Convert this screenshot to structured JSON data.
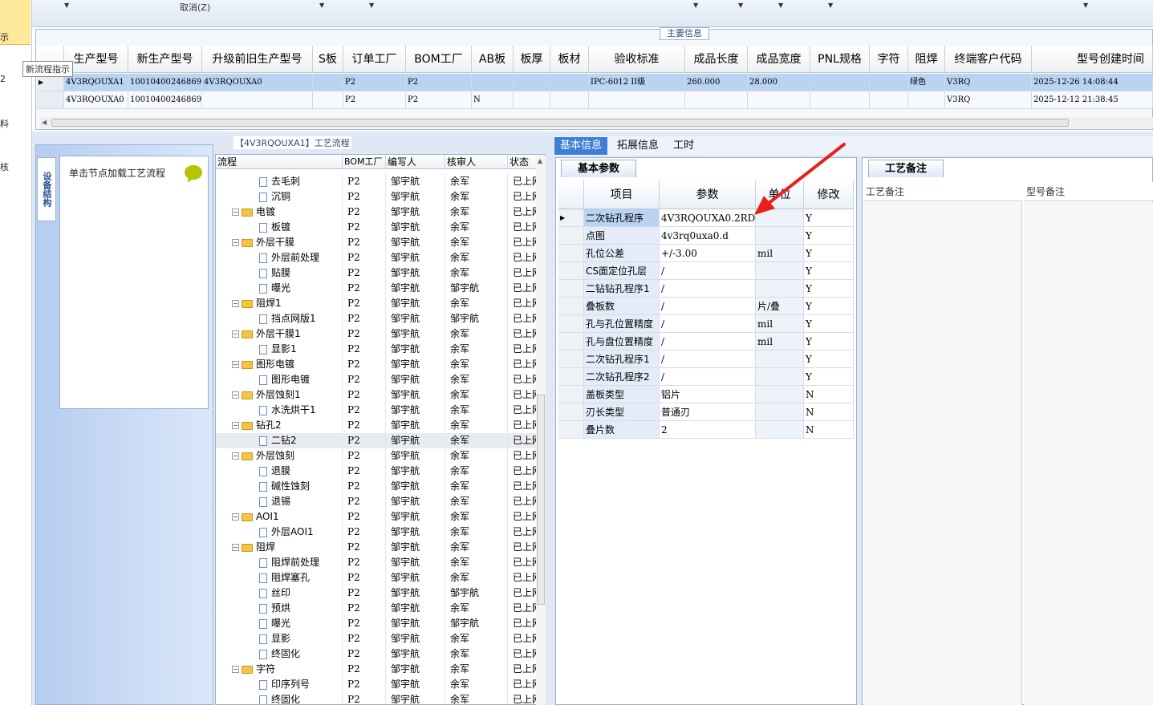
{
  "toolbar": {
    "cancel_label": "取消(Z)"
  },
  "leftstrip": {
    "items": [
      "示",
      "2",
      "料",
      "核"
    ]
  },
  "tooltip": "新流程指示",
  "main_info": {
    "title": "主要信息",
    "columns": [
      "生产型号",
      "新生产型号",
      "升级前旧生产型号",
      "S板",
      "订单工厂",
      "BOM工厂",
      "AB板",
      "板厚",
      "板材",
      "验收标准",
      "成品长度",
      "成品宽度",
      "PNL规格",
      "字符",
      "阻焊",
      "终端客户代码",
      "型号创建时间"
    ],
    "rows": [
      [
        "4V3RQOUXA1",
        "10010400246869",
        "4V3RQOUXA0",
        "",
        "P2",
        "P2",
        "",
        "",
        "",
        "IPC-6012 II级",
        "260.000",
        "28.000",
        "",
        "",
        "绿色",
        "V3RQ",
        "2025-12-26 14:08:44"
      ],
      [
        "4V3RQOUXA0",
        "10010400246869",
        "",
        "",
        "P2",
        "P2",
        "N",
        "",
        "",
        "",
        "",
        "",
        "",
        "",
        "",
        "V3RQ",
        "2025-12-12 21:38:45"
      ]
    ]
  },
  "side": {
    "tab_label": "设备结构",
    "hint": "单击节点加载工艺流程"
  },
  "flow": {
    "title": "【4V3RQOUXA1】工艺流程",
    "columns": [
      "流程",
      "BOM工厂",
      "编写人",
      "核审人",
      "状态"
    ],
    "rows": [
      {
        "name": "去毛刺",
        "level": 2,
        "bom": "P2",
        "writer": "邹宇航",
        "reviewer": "余军",
        "status": "已上网"
      },
      {
        "name": "沉铜",
        "level": 2,
        "bom": "P2",
        "writer": "邹宇航",
        "reviewer": "余军",
        "status": "已上网"
      },
      {
        "name": "电镀",
        "level": 1,
        "bom": "P2",
        "writer": "邹宇航",
        "reviewer": "余军",
        "status": "已上网"
      },
      {
        "name": "板镀",
        "level": 2,
        "bom": "P2",
        "writer": "邹宇航",
        "reviewer": "余军",
        "status": "已上网"
      },
      {
        "name": "外层干膜",
        "level": 1,
        "bom": "P2",
        "writer": "邹宇航",
        "reviewer": "余军",
        "status": "已上网"
      },
      {
        "name": "外层前处理",
        "level": 2,
        "bom": "P2",
        "writer": "邹宇航",
        "reviewer": "余军",
        "status": "已上网"
      },
      {
        "name": "贴膜",
        "level": 2,
        "bom": "P2",
        "writer": "邹宇航",
        "reviewer": "余军",
        "status": "已上网"
      },
      {
        "name": "曝光",
        "level": 2,
        "bom": "P2",
        "writer": "邹宇航",
        "reviewer": "邹宇航",
        "status": "已上网"
      },
      {
        "name": "阻焊1",
        "level": 1,
        "bom": "P2",
        "writer": "邹宇航",
        "reviewer": "余军",
        "status": "已上网"
      },
      {
        "name": "挡点网版1",
        "level": 2,
        "bom": "P2",
        "writer": "邹宇航",
        "reviewer": "邹宇航",
        "status": "已上网"
      },
      {
        "name": "外层干膜1",
        "level": 1,
        "bom": "P2",
        "writer": "邹宇航",
        "reviewer": "余军",
        "status": "已上网"
      },
      {
        "name": "显影1",
        "level": 2,
        "bom": "P2",
        "writer": "邹宇航",
        "reviewer": "余军",
        "status": "已上网"
      },
      {
        "name": "图形电镀",
        "level": 1,
        "bom": "P2",
        "writer": "邹宇航",
        "reviewer": "余军",
        "status": "已上网"
      },
      {
        "name": "图形电镀",
        "level": 2,
        "bom": "P2",
        "writer": "邹宇航",
        "reviewer": "余军",
        "status": "已上网"
      },
      {
        "name": "外层蚀刻1",
        "level": 1,
        "bom": "P2",
        "writer": "邹宇航",
        "reviewer": "余军",
        "status": "已上网"
      },
      {
        "name": "水洗烘干1",
        "level": 2,
        "bom": "P2",
        "writer": "邹宇航",
        "reviewer": "余军",
        "status": "已上网"
      },
      {
        "name": "钻孔2",
        "level": 1,
        "bom": "P2",
        "writer": "邹宇航",
        "reviewer": "余军",
        "status": "已上网"
      },
      {
        "name": "二钻2",
        "level": 2,
        "bom": "P2",
        "writer": "邹宇航",
        "reviewer": "余军",
        "status": "已上网",
        "selected": true
      },
      {
        "name": "外层蚀刻",
        "level": 1,
        "bom": "P2",
        "writer": "邹宇航",
        "reviewer": "余军",
        "status": "已上网"
      },
      {
        "name": "退膜",
        "level": 2,
        "bom": "P2",
        "writer": "邹宇航",
        "reviewer": "余军",
        "status": "已上网"
      },
      {
        "name": "碱性蚀刻",
        "level": 2,
        "bom": "P2",
        "writer": "邹宇航",
        "reviewer": "余军",
        "status": "已上网"
      },
      {
        "name": "退锡",
        "level": 2,
        "bom": "P2",
        "writer": "邹宇航",
        "reviewer": "余军",
        "status": "已上网"
      },
      {
        "name": "AOI1",
        "level": 1,
        "bom": "P2",
        "writer": "邹宇航",
        "reviewer": "余军",
        "status": "已上网"
      },
      {
        "name": "外层AOI1",
        "level": 2,
        "bom": "P2",
        "writer": "邹宇航",
        "reviewer": "余军",
        "status": "已上网"
      },
      {
        "name": "阻焊",
        "level": 1,
        "bom": "P2",
        "writer": "邹宇航",
        "reviewer": "余军",
        "status": "已上网"
      },
      {
        "name": "阻焊前处理",
        "level": 2,
        "bom": "P2",
        "writer": "邹宇航",
        "reviewer": "余军",
        "status": "已上网"
      },
      {
        "name": "阻焊塞孔",
        "level": 2,
        "bom": "P2",
        "writer": "邹宇航",
        "reviewer": "余军",
        "status": "已上网"
      },
      {
        "name": "丝印",
        "level": 2,
        "bom": "P2",
        "writer": "邹宇航",
        "reviewer": "邹宇航",
        "status": "已上网"
      },
      {
        "name": "预烘",
        "level": 2,
        "bom": "P2",
        "writer": "邹宇航",
        "reviewer": "余军",
        "status": "已上网"
      },
      {
        "name": "曝光",
        "level": 2,
        "bom": "P2",
        "writer": "邹宇航",
        "reviewer": "邹宇航",
        "status": "已上网"
      },
      {
        "name": "显影",
        "level": 2,
        "bom": "P2",
        "writer": "邹宇航",
        "reviewer": "余军",
        "status": "已上网"
      },
      {
        "name": "终固化",
        "level": 2,
        "bom": "P2",
        "writer": "邹宇航",
        "reviewer": "余军",
        "status": "已上网"
      },
      {
        "name": "字符",
        "level": 1,
        "bom": "P2",
        "writer": "邹宇航",
        "reviewer": "余军",
        "status": "已上网"
      },
      {
        "name": "印序列号",
        "level": 2,
        "bom": "P2",
        "writer": "邹宇航",
        "reviewer": "余军",
        "status": "已上网"
      },
      {
        "name": "终固化",
        "level": 2,
        "bom": "P2",
        "writer": "邹宇航",
        "reviewer": "余军",
        "status": "已上网"
      }
    ]
  },
  "tabs": [
    "基本信息",
    "拓展信息",
    "工时"
  ],
  "params": {
    "subtab": "基本参数",
    "columns": [
      "项目",
      "参数",
      "单位",
      "修改"
    ],
    "rows": [
      [
        "二次钻孔程序",
        "4V3RQOUXA0.2RD1",
        "",
        "Y"
      ],
      [
        "点图",
        "4v3rq0uxa0.d",
        "",
        "Y"
      ],
      [
        "孔位公差",
        "+/-3.00",
        "mil",
        "Y"
      ],
      [
        "CS面定位孔层",
        "/",
        "",
        "Y"
      ],
      [
        "二钻钻孔程序1",
        "/",
        "",
        "Y"
      ],
      [
        "叠板数",
        "/",
        "片/叠",
        "Y"
      ],
      [
        "孔与孔位置精度",
        "/",
        "mil",
        "Y"
      ],
      [
        "孔与盘位置精度",
        "/",
        "mil",
        "Y"
      ],
      [
        "二次钻孔程序1",
        "/",
        "",
        "Y"
      ],
      [
        "二次钻孔程序2",
        "/",
        "",
        "Y"
      ],
      [
        "盖板类型",
        "铝片",
        "",
        "N"
      ],
      [
        "刃长类型",
        "普通刃",
        "",
        "N"
      ],
      [
        "叠片数",
        "2",
        "",
        "N"
      ]
    ]
  },
  "notes": {
    "subtab": "工艺备注",
    "col1": "工艺备注",
    "col2": "型号备注"
  },
  "colors": {
    "accent": "#3d7ed6",
    "selected_row": "#b9d3f2",
    "arrow": "#e8201a",
    "folder": "#f4c542"
  }
}
